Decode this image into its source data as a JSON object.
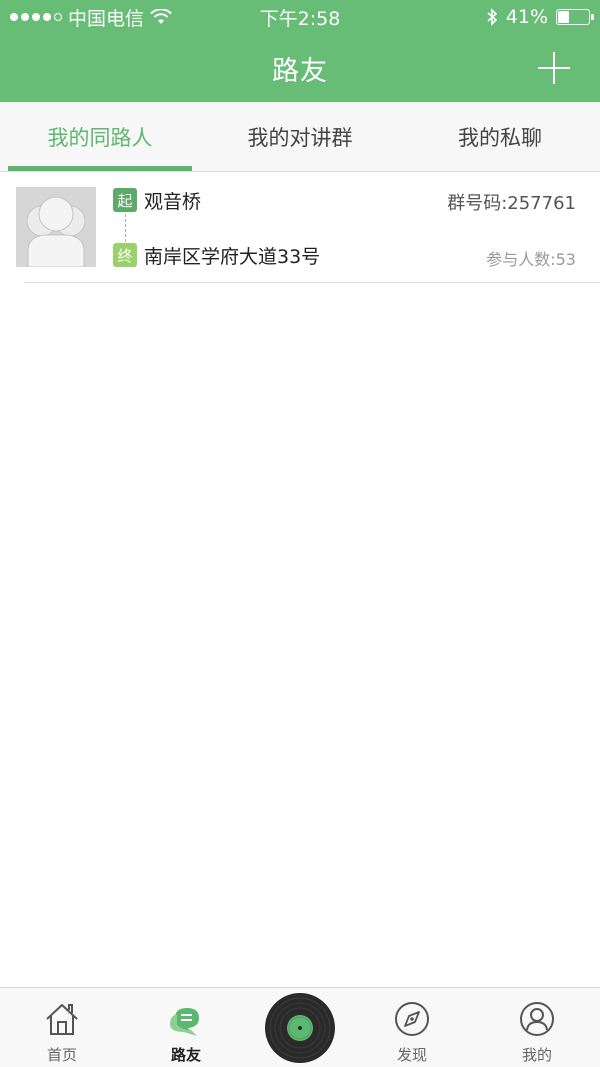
{
  "status_bar": {
    "carrier": "中国电信",
    "time": "下午2:58",
    "battery_text": "41%",
    "battery_level": 0.41,
    "icons": [
      "signal-icon",
      "wifi-icon",
      "bluetooth-icon",
      "battery-icon"
    ]
  },
  "nav": {
    "title": "路友",
    "add_icon": "plus-icon"
  },
  "tabs": [
    {
      "label": "我的同路人",
      "active": true
    },
    {
      "label": "我的对讲群",
      "active": false
    },
    {
      "label": "我的私聊",
      "active": false
    }
  ],
  "list": {
    "items": [
      {
        "start_badge": "起",
        "start_name": "观音桥",
        "end_badge": "终",
        "end_name": "南岸区学府大道33号",
        "group_code": "群号码:257761",
        "member_count": "参与人数:53"
      }
    ]
  },
  "tab_bar": {
    "items": [
      {
        "label": "首页",
        "icon": "home-icon",
        "active": false
      },
      {
        "label": "路友",
        "icon": "chat-bubbles-icon",
        "active": true
      },
      {
        "label": "",
        "icon": "vinyl-record-icon",
        "active": false
      },
      {
        "label": "发现",
        "icon": "compass-icon",
        "active": false
      },
      {
        "label": "我的",
        "icon": "user-icon",
        "active": false
      }
    ]
  },
  "colors": {
    "brand_green": "#68bd76",
    "active_tab_green": "#5cb870",
    "start_badge_green": "#5ca96a",
    "end_badge_green": "#9bd16a"
  }
}
